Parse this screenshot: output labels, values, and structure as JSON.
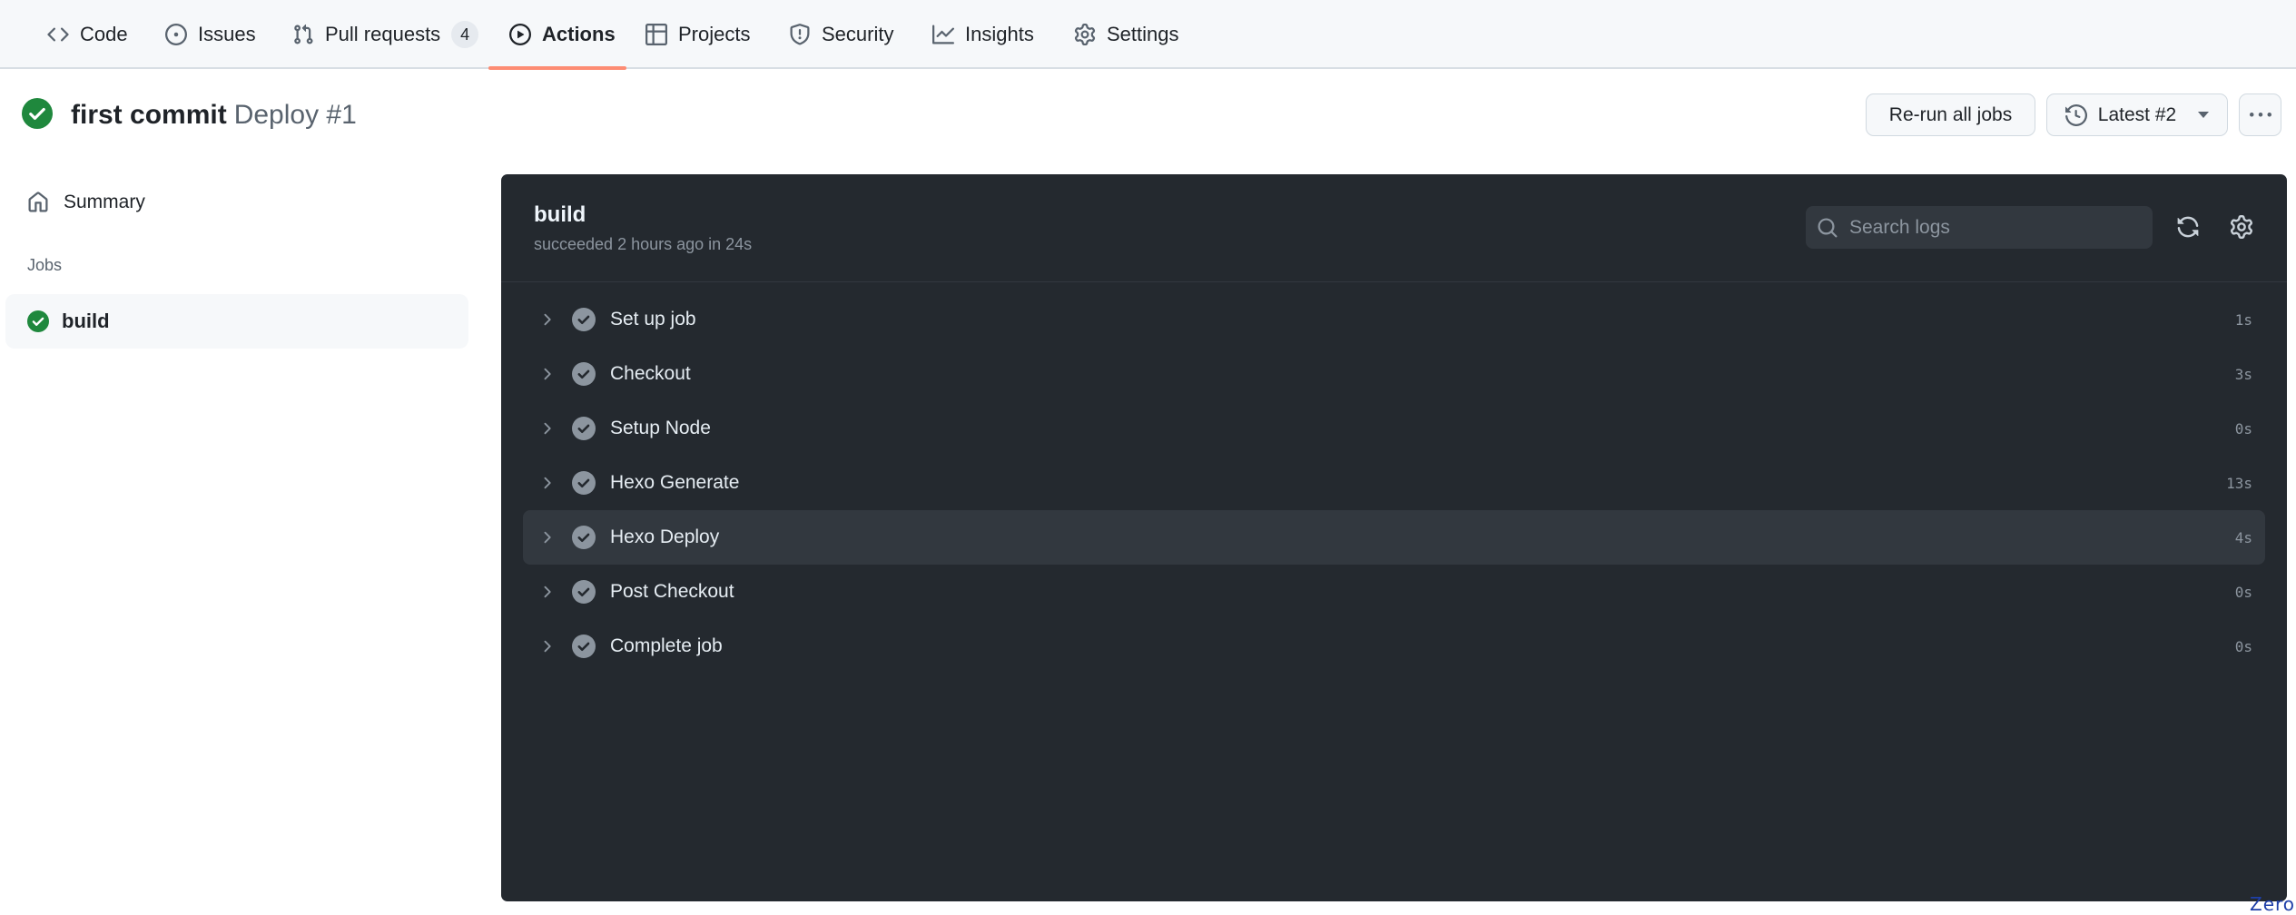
{
  "nav": {
    "tabs": [
      {
        "label": "Code",
        "icon": "code-icon"
      },
      {
        "label": "Issues",
        "icon": "issue-opened-icon"
      },
      {
        "label": "Pull requests",
        "icon": "git-pull-request-icon",
        "count": "4"
      },
      {
        "label": "Actions",
        "icon": "play-icon",
        "active": true
      },
      {
        "label": "Projects",
        "icon": "table-icon"
      },
      {
        "label": "Security",
        "icon": "shield-icon"
      },
      {
        "label": "Insights",
        "icon": "graph-icon"
      },
      {
        "label": "Settings",
        "icon": "gear-icon"
      }
    ],
    "accent_color": "#fd8c73"
  },
  "run": {
    "title": "first commit",
    "workflow": "Deploy #1",
    "status": "success",
    "status_color": "#1f883d"
  },
  "actions": {
    "rerun_label": "Re-run all jobs",
    "attempt_label": "Latest #2",
    "more_label": "More options"
  },
  "sidebar": {
    "summary_label": "Summary",
    "jobs_heading": "Jobs",
    "jobs": [
      {
        "name": "build",
        "status": "success"
      }
    ]
  },
  "log": {
    "job_name": "build",
    "job_meta": "succeeded 2 hours ago in 24s",
    "search_placeholder": "Search logs",
    "steps": [
      {
        "name": "Set up job",
        "duration": "1s"
      },
      {
        "name": "Checkout",
        "duration": "3s"
      },
      {
        "name": "Setup Node",
        "duration": "0s"
      },
      {
        "name": "Hexo Generate",
        "duration": "13s"
      },
      {
        "name": "Hexo Deploy",
        "duration": "4s",
        "hovered": true
      },
      {
        "name": "Post Checkout",
        "duration": "0s"
      },
      {
        "name": "Complete job",
        "duration": "0s"
      }
    ]
  },
  "watermark": "Zero"
}
